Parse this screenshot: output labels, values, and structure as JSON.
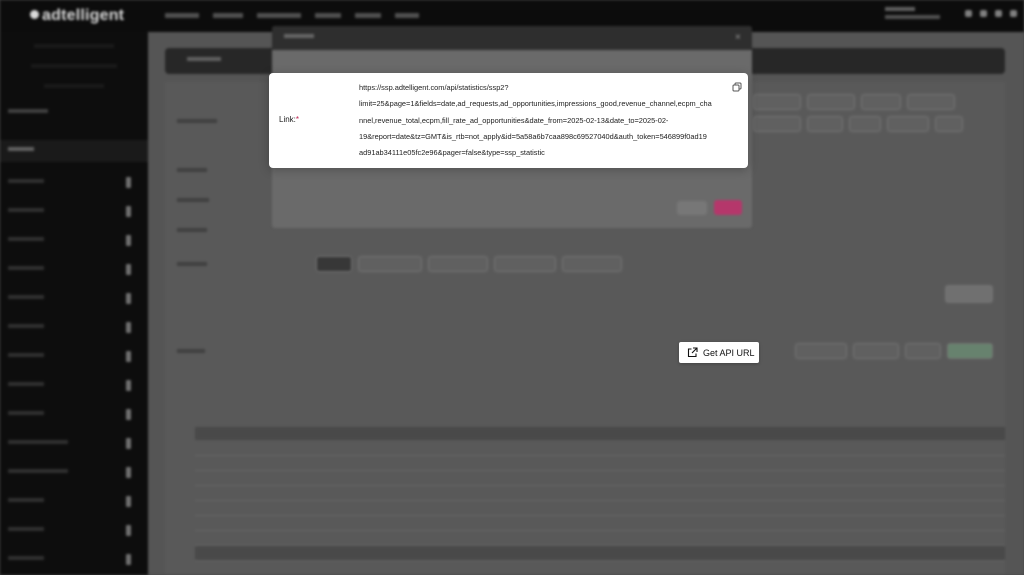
{
  "header": {
    "logo": "adtelligent"
  },
  "link_card": {
    "label": "Link:",
    "required_mark": "*",
    "url_lines": [
      "https://ssp.adtelligent.com/api/statistics/ssp2?",
      "limit=25&page=1&fields=date,ad_requests,ad_opportunities,impressions_good,revenue_channel,ecpm_cha",
      "nnel,revenue_total,ecpm,fill_rate_ad_opportunities&date_from=2025-02-13&date_to=2025-02-",
      "19&report=date&tz=GMT&is_rtb=not_apply&id=5a58a6b7caa898c69527040d&auth_token=546899f0ad19",
      "ad91ab34111e05fc2e96&pager=false&type=ssp_statistic"
    ],
    "copy_icon": "copy-icon"
  },
  "toolbar": {
    "get_api_url_label": "Get API URL",
    "get_api_url_icon": "external-link-icon"
  },
  "colors": {
    "accent": "#b5376b",
    "sidebar_bg": "#0e0e0e"
  }
}
